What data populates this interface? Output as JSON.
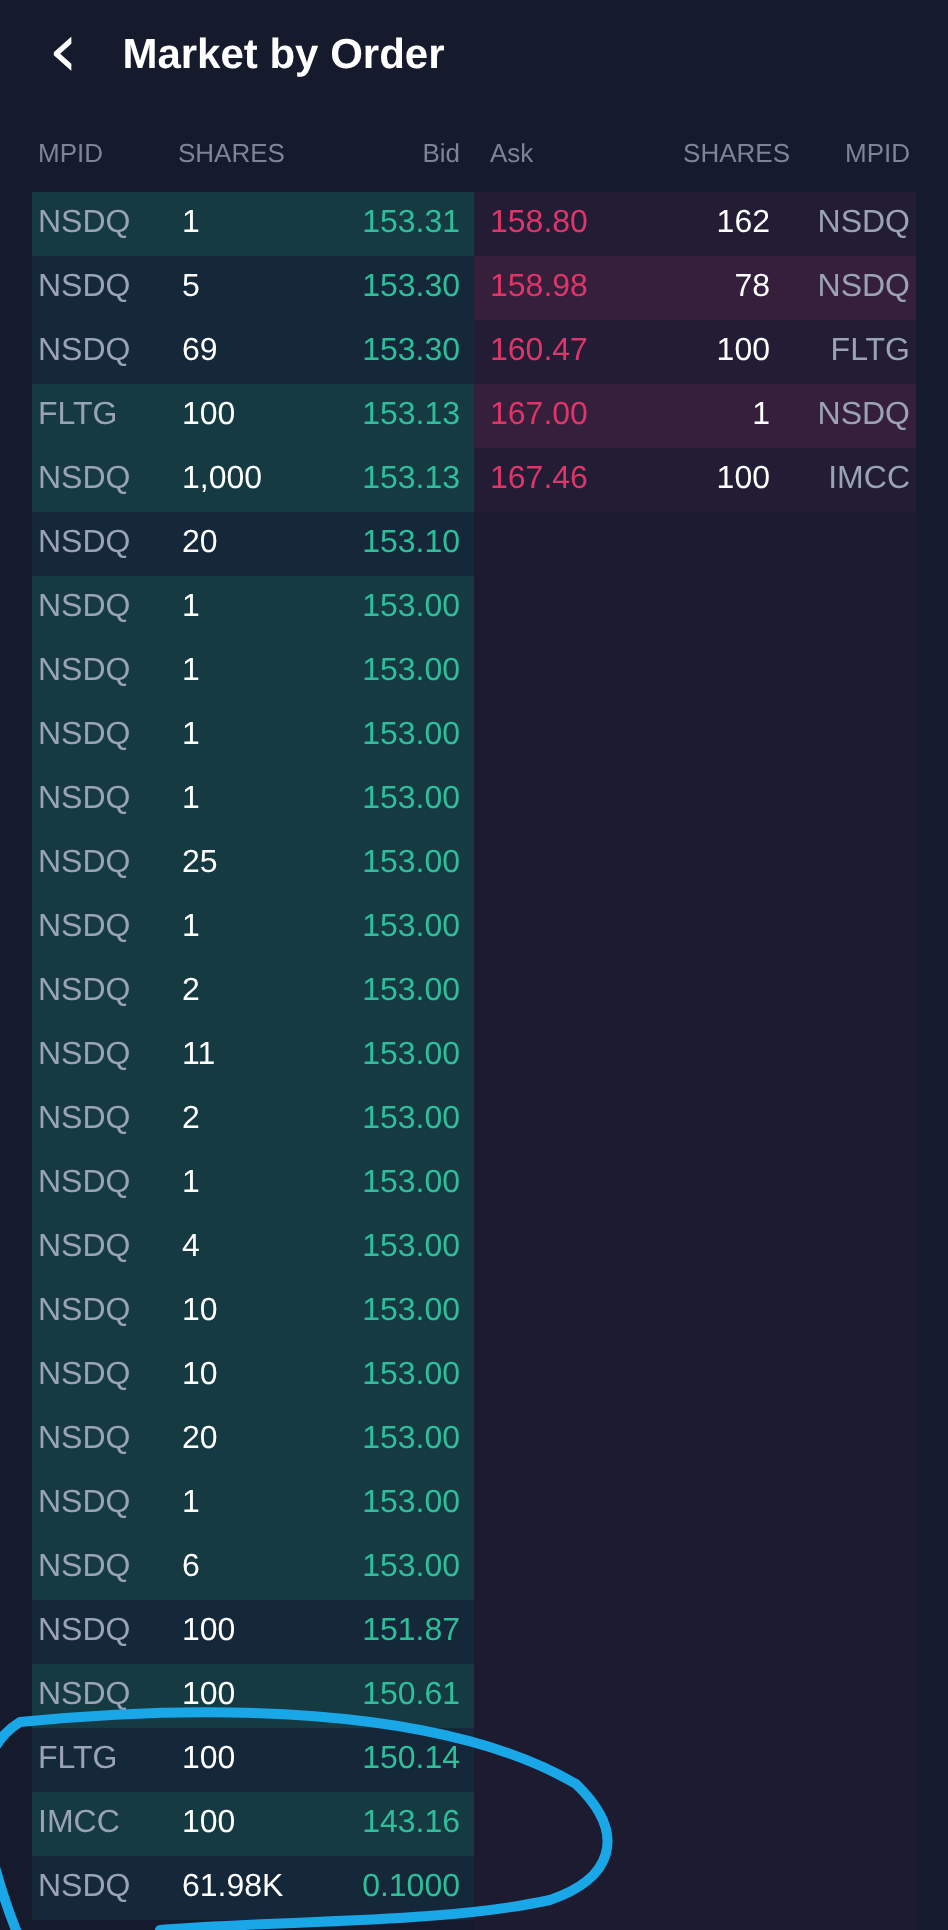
{
  "header": {
    "back_icon": "‹",
    "title": "Market by Order"
  },
  "columns": {
    "bid": [
      "MPID",
      "SHARES",
      "Bid"
    ],
    "ask": [
      "Ask",
      "SHARES",
      "MPID"
    ]
  },
  "bids": [
    {
      "mpid": "NSDQ",
      "shares": "1",
      "price": "153.31",
      "shaded": true
    },
    {
      "mpid": "NSDQ",
      "shares": "5",
      "price": "153.30",
      "shaded": false
    },
    {
      "mpid": "NSDQ",
      "shares": "69",
      "price": "153.30",
      "shaded": false
    },
    {
      "mpid": "FLTG",
      "shares": "100",
      "price": "153.13",
      "shaded": true
    },
    {
      "mpid": "NSDQ",
      "shares": "1,000",
      "price": "153.13",
      "shaded": true
    },
    {
      "mpid": "NSDQ",
      "shares": "20",
      "price": "153.10",
      "shaded": false
    },
    {
      "mpid": "NSDQ",
      "shares": "1",
      "price": "153.00",
      "shaded": true
    },
    {
      "mpid": "NSDQ",
      "shares": "1",
      "price": "153.00",
      "shaded": true
    },
    {
      "mpid": "NSDQ",
      "shares": "1",
      "price": "153.00",
      "shaded": true
    },
    {
      "mpid": "NSDQ",
      "shares": "1",
      "price": "153.00",
      "shaded": true
    },
    {
      "mpid": "NSDQ",
      "shares": "25",
      "price": "153.00",
      "shaded": true
    },
    {
      "mpid": "NSDQ",
      "shares": "1",
      "price": "153.00",
      "shaded": true
    },
    {
      "mpid": "NSDQ",
      "shares": "2",
      "price": "153.00",
      "shaded": true
    },
    {
      "mpid": "NSDQ",
      "shares": "11",
      "price": "153.00",
      "shaded": true
    },
    {
      "mpid": "NSDQ",
      "shares": "2",
      "price": "153.00",
      "shaded": true
    },
    {
      "mpid": "NSDQ",
      "shares": "1",
      "price": "153.00",
      "shaded": true
    },
    {
      "mpid": "NSDQ",
      "shares": "4",
      "price": "153.00",
      "shaded": true
    },
    {
      "mpid": "NSDQ",
      "shares": "10",
      "price": "153.00",
      "shaded": true
    },
    {
      "mpid": "NSDQ",
      "shares": "10",
      "price": "153.00",
      "shaded": true
    },
    {
      "mpid": "NSDQ",
      "shares": "20",
      "price": "153.00",
      "shaded": true
    },
    {
      "mpid": "NSDQ",
      "shares": "1",
      "price": "153.00",
      "shaded": true
    },
    {
      "mpid": "NSDQ",
      "shares": "6",
      "price": "153.00",
      "shaded": true
    },
    {
      "mpid": "NSDQ",
      "shares": "100",
      "price": "151.87",
      "shaded": false
    },
    {
      "mpid": "NSDQ",
      "shares": "100",
      "price": "150.61",
      "shaded": true
    },
    {
      "mpid": "FLTG",
      "shares": "100",
      "price": "150.14",
      "shaded": false
    },
    {
      "mpid": "IMCC",
      "shares": "100",
      "price": "143.16",
      "shaded": true
    },
    {
      "mpid": "NSDQ",
      "shares": "61.98K",
      "price": "0.1000",
      "shaded": false
    }
  ],
  "asks": [
    {
      "price": "158.80",
      "shares": "162",
      "mpid": "NSDQ",
      "shaded": false
    },
    {
      "price": "158.98",
      "shares": "78",
      "mpid": "NSDQ",
      "shaded": true
    },
    {
      "price": "160.47",
      "shares": "100",
      "mpid": "FLTG",
      "shaded": false
    },
    {
      "price": "167.00",
      "shares": "1",
      "mpid": "NSDQ",
      "shaded": true
    },
    {
      "price": "167.46",
      "shares": "100",
      "mpid": "IMCC",
      "shaded": false
    }
  ]
}
